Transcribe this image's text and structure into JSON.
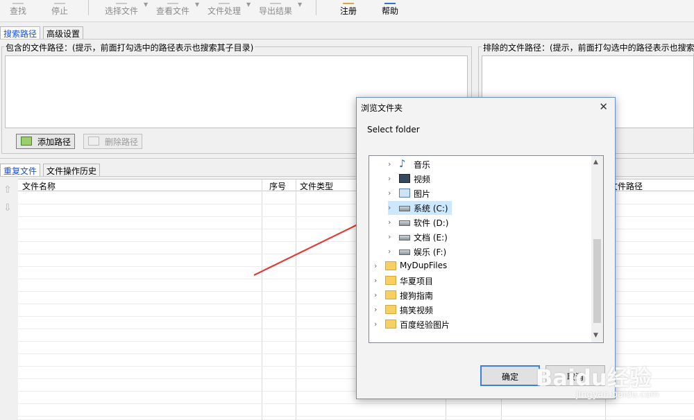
{
  "toolbar": {
    "find": "查找",
    "stop": "停止",
    "select_files": "选择文件",
    "view_files": "查看文件",
    "file_processing": "文件处理",
    "export_results": "导出结果",
    "register": "注册",
    "help": "帮助"
  },
  "top_tabs": {
    "search_paths": "搜索路径",
    "advanced": "高级设置"
  },
  "include_group": {
    "title": "包含的文件路径：(提示，前面打勾选中的路径表示也搜索其子目录)",
    "add_button": "添加路径",
    "delete_button": "删除路径"
  },
  "exclude_group": {
    "title": "排除的文件路径：(提示，前面打勾选中的路径表示也搜索"
  },
  "bottom_tabs": {
    "duplicates": "重复文件",
    "history": "文件操作历史"
  },
  "grid": {
    "columns": [
      "文件名称",
      "序号",
      "文件类型",
      "文件路径"
    ]
  },
  "dialog": {
    "title": "浏览文件夹",
    "label": "Select folder",
    "tree": [
      {
        "label": "音乐",
        "icon": "music-icon"
      },
      {
        "label": "视频",
        "icon": "video-icon"
      },
      {
        "label": "图片",
        "icon": "picture-icon"
      },
      {
        "label": "系统 (C:)",
        "icon": "drive-icon",
        "selected": true
      },
      {
        "label": "软件 (D:)",
        "icon": "drive-icon"
      },
      {
        "label": "文档 (E:)",
        "icon": "drive-icon"
      },
      {
        "label": "娱乐 (F:)",
        "icon": "drive-icon"
      },
      {
        "label": "MyDupFiles",
        "icon": "folder-icon"
      },
      {
        "label": "华夏项目",
        "icon": "folder-icon"
      },
      {
        "label": "搜狗指南",
        "icon": "folder-icon"
      },
      {
        "label": "搞笑视频",
        "icon": "folder-icon"
      },
      {
        "label": "百度经验图片",
        "icon": "folder-icon"
      }
    ],
    "ok": "确定",
    "cancel": "取消"
  },
  "watermark": {
    "line1": "Baidu经验",
    "line2": "jingyan.baidu.com"
  },
  "colors": {
    "annotation_arrow": "#e53935",
    "selected_row": "#cce8ff",
    "active_tab": "#1a4fd6"
  }
}
